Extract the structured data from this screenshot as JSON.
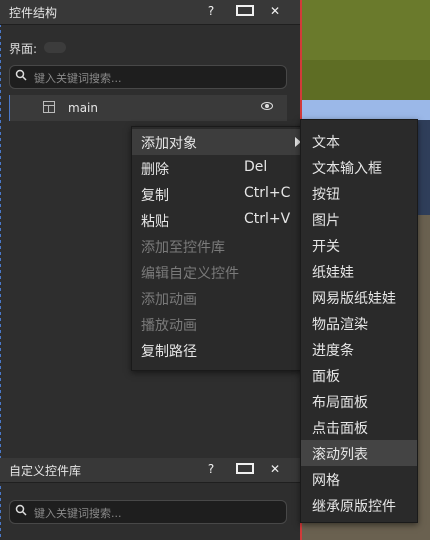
{
  "widget_panel": {
    "title": "控件结构",
    "help": "?",
    "close": "✕",
    "interface_label": "界面:",
    "search_placeholder": "键入关键词搜索...",
    "tree_item": "main"
  },
  "custom_panel": {
    "title": "自定义控件库",
    "help": "?",
    "close": "✕",
    "search_placeholder": "键入关键词搜索..."
  },
  "context_menu": {
    "items": [
      {
        "label": "添加对象",
        "shortcut": "",
        "enabled": true,
        "submenu": true
      },
      {
        "label": "删除",
        "shortcut": "Del",
        "enabled": true
      },
      {
        "label": "复制",
        "shortcut": "Ctrl+C",
        "enabled": true
      },
      {
        "label": "粘贴",
        "shortcut": "Ctrl+V",
        "enabled": true
      },
      {
        "label": "添加至控件库",
        "shortcut": "",
        "enabled": false
      },
      {
        "label": "编辑自定义控件",
        "shortcut": "",
        "enabled": false
      },
      {
        "label": "添加动画",
        "shortcut": "",
        "enabled": false
      },
      {
        "label": "播放动画",
        "shortcut": "",
        "enabled": false
      },
      {
        "label": "复制路径",
        "shortcut": "",
        "enabled": true
      }
    ]
  },
  "submenu": {
    "items": [
      "文本",
      "文本输入框",
      "按钮",
      "图片",
      "开关",
      "纸娃娃",
      "网易版纸娃娃",
      "物品渲染",
      "进度条",
      "面板",
      "布局面板",
      "点击面板",
      "滚动列表",
      "网格",
      "继承原版控件"
    ],
    "highlighted": "滚动列表"
  }
}
